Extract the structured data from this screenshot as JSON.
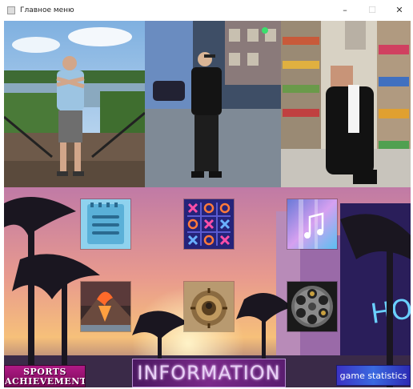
{
  "window": {
    "title": "Главное меню",
    "controls": {
      "minimize": "–",
      "maximize": "☐",
      "close": "✕"
    }
  },
  "tiles": [
    {
      "name": "notepad",
      "icon": "notepad-icon"
    },
    {
      "name": "tic-tac-toe",
      "icon": "tic-tac-toe-icon"
    },
    {
      "name": "music",
      "icon": "music-note-icon"
    },
    {
      "name": "volcano",
      "icon": "volcano-icon"
    },
    {
      "name": "minesweeper",
      "icon": "mine-icon"
    },
    {
      "name": "revolver",
      "icon": "revolver-cylinder-icon"
    }
  ],
  "buttons": {
    "sports_line1": "SPORTS",
    "sports_line2": "ACHIEVEMENTS",
    "information": "INFORMATION",
    "game_statistics": "game statistics"
  },
  "colors": {
    "sports_bg": "#9e1478",
    "information_bg": "#5a1d70",
    "stats_bg": "#3a4ad8"
  }
}
